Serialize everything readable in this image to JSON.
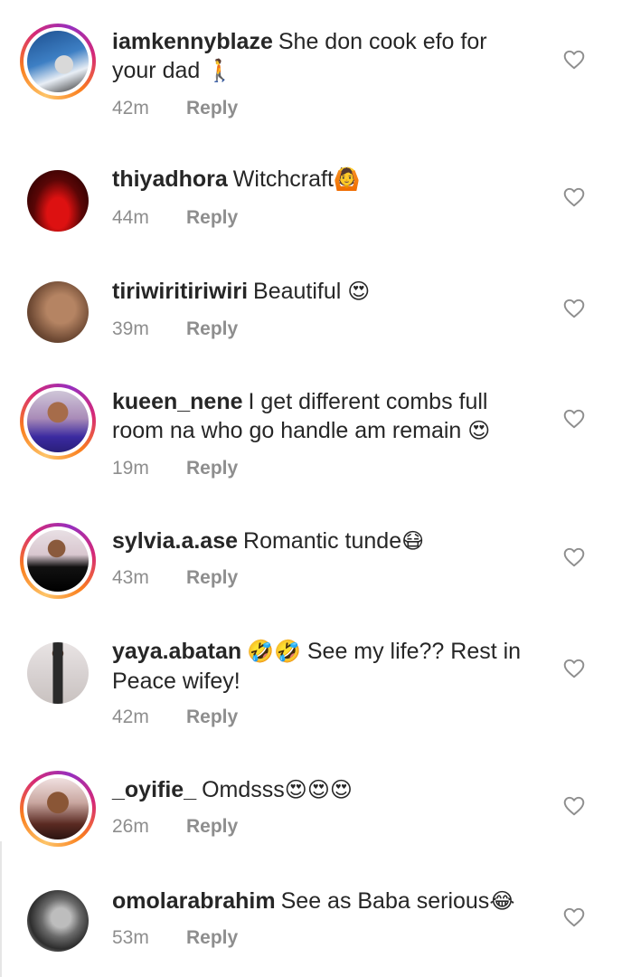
{
  "reply_label": "Reply",
  "comments": [
    {
      "username": "iamkennyblaze",
      "text": "She don cook efo for your dad",
      "emoji": "🚶",
      "time": "42m"
    },
    {
      "username": "thiyadhora",
      "text": "Witchcraft",
      "emoji": "🙆",
      "time": "44m"
    },
    {
      "username": "tiriwiritiriwiri",
      "text": "Beautiful",
      "emoji": "😍",
      "time": "39m"
    },
    {
      "username": "kueen_nene",
      "text": "I get different combs  full room na who go handle am remain",
      "emoji": "😍",
      "time": "19m"
    },
    {
      "username": "sylvia.a.ase",
      "text": "Romantic tunde",
      "emoji": "😷",
      "time": "43m"
    },
    {
      "username": "yaya.abatan",
      "text": "See my life?? Rest in Peace wifey!",
      "emoji": "🤣🤣",
      "time": "42m"
    },
    {
      "username": "_oyifie_",
      "text": "Omdsss",
      "emoji": "😍😍😍",
      "time": "26m"
    },
    {
      "username": "omolarabrahim",
      "text": "See as Baba serious",
      "emoji": "😂",
      "time": "53m"
    }
  ]
}
